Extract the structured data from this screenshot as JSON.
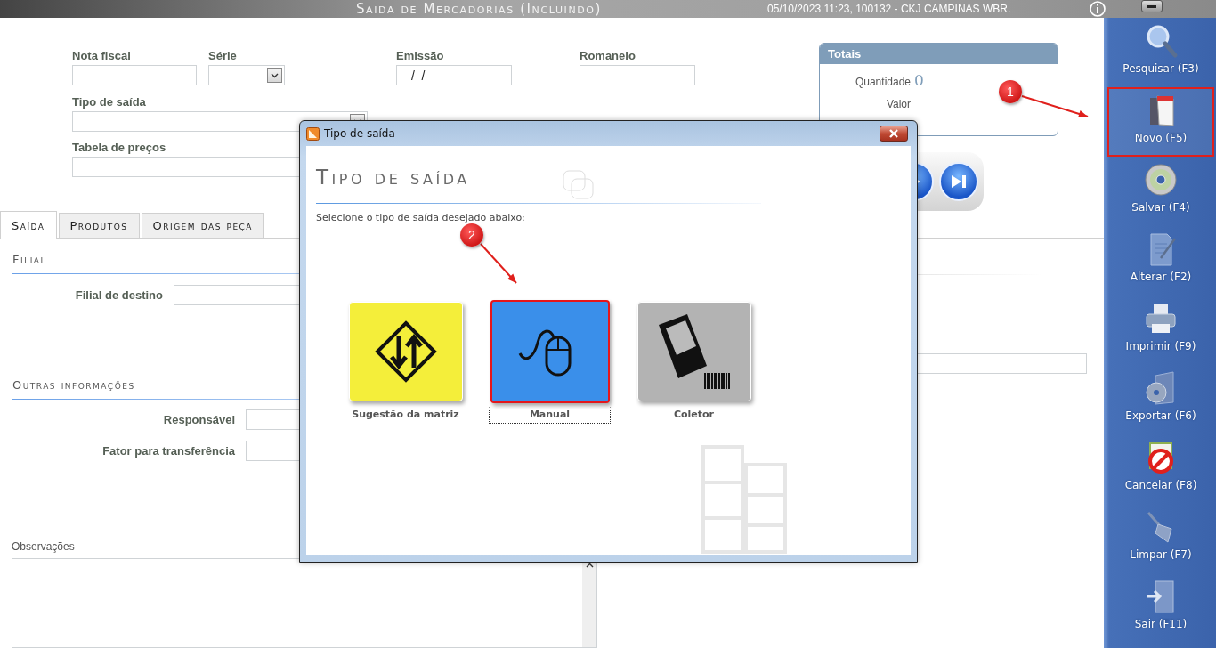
{
  "title_bar": {
    "title": "Saida de Mercadorias (Incluindo)",
    "info": "05/10/2023 11:23, 100132 - CKJ CAMPINAS WBR."
  },
  "form": {
    "fields": [
      {
        "label": "Nota fiscal",
        "kind": "text"
      },
      {
        "label": "Série",
        "kind": "select"
      },
      {
        "label": "Emissão",
        "kind": "text",
        "value": " /  /"
      },
      {
        "label": "Romaneio",
        "kind": "text"
      }
    ],
    "tipo_de_saida": {
      "label": "Tipo de saída"
    },
    "tabela_de_precos": {
      "label": "Tabela de preços"
    }
  },
  "totais": {
    "title": "Totais",
    "rows": [
      {
        "label": "Quantidade",
        "value": "0"
      },
      {
        "label": "Valor"
      }
    ]
  },
  "tabs": [
    {
      "label": "Saída",
      "selected": true
    },
    {
      "label": "Produtos",
      "selected": false
    },
    {
      "label": "Origem das peça",
      "selected": false
    }
  ],
  "filial": {
    "heading": "Filial",
    "fields": [
      {
        "label": "Filial de destino"
      }
    ]
  },
  "outras_informacoes": {
    "heading": "Outras informações",
    "fields": [
      {
        "label": "Responsável"
      },
      {
        "label": "Fator para transferência"
      }
    ]
  },
  "observacoes": {
    "label": "Observações"
  },
  "dialog": {
    "title": "Tipo de saída",
    "heading": "Tipo de saída",
    "instruction": "Selecione o tipo de saída desejado abaixo:",
    "options": [
      {
        "label": "Sugestão da matriz",
        "kind": "suggestion",
        "color": "#f4ee3a",
        "selected": false,
        "highlighted": false
      },
      {
        "label": "Manual",
        "kind": "manual",
        "color": "#3a8fea",
        "selected": true,
        "highlighted": true
      },
      {
        "label": "Coletor",
        "kind": "collector",
        "color": "#b3b3b3",
        "selected": false,
        "highlighted": false
      }
    ]
  },
  "sidebar": {
    "items": [
      {
        "label": "Pesquisar (F3)",
        "kind": "search",
        "highlighted": false
      },
      {
        "label": "Novo (F5)",
        "kind": "new",
        "highlighted": true
      },
      {
        "label": "Salvar (F4)",
        "kind": "save",
        "highlighted": false
      },
      {
        "label": "Alterar (F2)",
        "kind": "edit",
        "highlighted": false
      },
      {
        "label": "Imprimir (F9)",
        "kind": "print",
        "highlighted": false
      },
      {
        "label": "Exportar (F6)",
        "kind": "export",
        "highlighted": false
      },
      {
        "label": "Cancelar (F8)",
        "kind": "cancel",
        "highlighted": false
      },
      {
        "label": "Limpar (F7)",
        "kind": "clear",
        "highlighted": false
      },
      {
        "label": "Sair (F11)",
        "kind": "exit",
        "highlighted": false
      }
    ]
  },
  "annotations": [
    {
      "label": "1",
      "kind": "to-sidebar"
    },
    {
      "label": "2",
      "kind": "to-option"
    }
  ]
}
